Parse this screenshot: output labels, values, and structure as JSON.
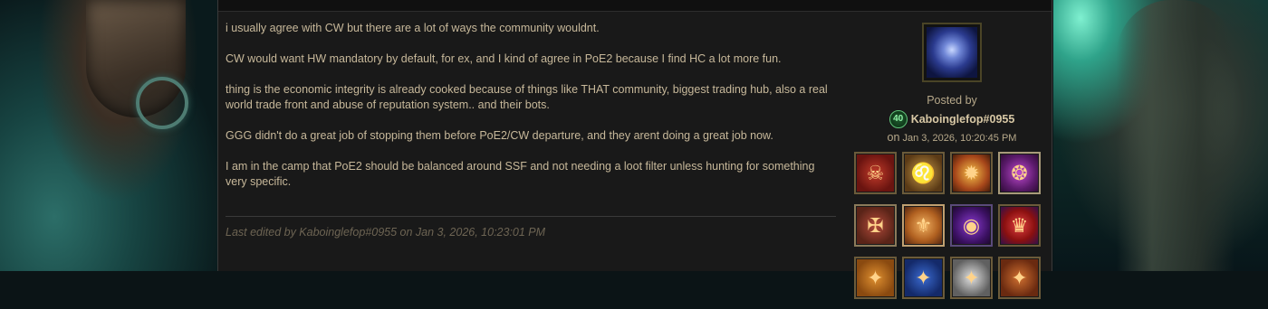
{
  "post": {
    "paragraphs": [
      "i usually agree with CW but there are a lot of ways the community wouldnt.",
      "CW would want HW mandatory by default, for ex, and I kind of agree in PoE2 because I find HC a lot more fun.",
      "thing is the economic integrity is already cooked because of things like THAT community, biggest trading hub, also a real world trade front and abuse of reputation system.. and their bots.",
      "GGG didn't do a great job of stopping them before PoE2/CW departure, and they arent doing a great job now.",
      "I am in the camp that PoE2 should be balanced around SSF and not needing a loot filter unless hunting for something very specific."
    ],
    "edited_note": "Last edited by Kaboinglefop#0955 on Jan 3, 2026, 10:23:01 PM"
  },
  "author": {
    "posted_by_label": "Posted by",
    "level": "40",
    "name": "Kaboinglefop#0955",
    "on_label": "on",
    "date": "Jan 3, 2026, 10:20:45 PM",
    "avatar_icon": "character-portrait-icon"
  },
  "badges": [
    {
      "icon": "demon-face-badge-icon",
      "glyph": "☠"
    },
    {
      "icon": "lion-badge-icon",
      "glyph": "♌"
    },
    {
      "icon": "sun-star-badge-icon",
      "glyph": "✹"
    },
    {
      "icon": "maw-badge-icon",
      "glyph": "❂"
    },
    {
      "icon": "cross-shield-badge-icon",
      "glyph": "✠"
    },
    {
      "icon": "wings-badge-icon",
      "glyph": "⚜"
    },
    {
      "icon": "eye-badge-icon",
      "glyph": "◉"
    },
    {
      "icon": "crown-flame-badge-icon",
      "glyph": "♛"
    },
    {
      "icon": "partial-badge-icon-9",
      "glyph": "✦"
    },
    {
      "icon": "partial-badge-icon-10",
      "glyph": "✦"
    },
    {
      "icon": "partial-badge-icon-11",
      "glyph": "✦"
    },
    {
      "icon": "partial-badge-icon-12",
      "glyph": "✦"
    }
  ]
}
